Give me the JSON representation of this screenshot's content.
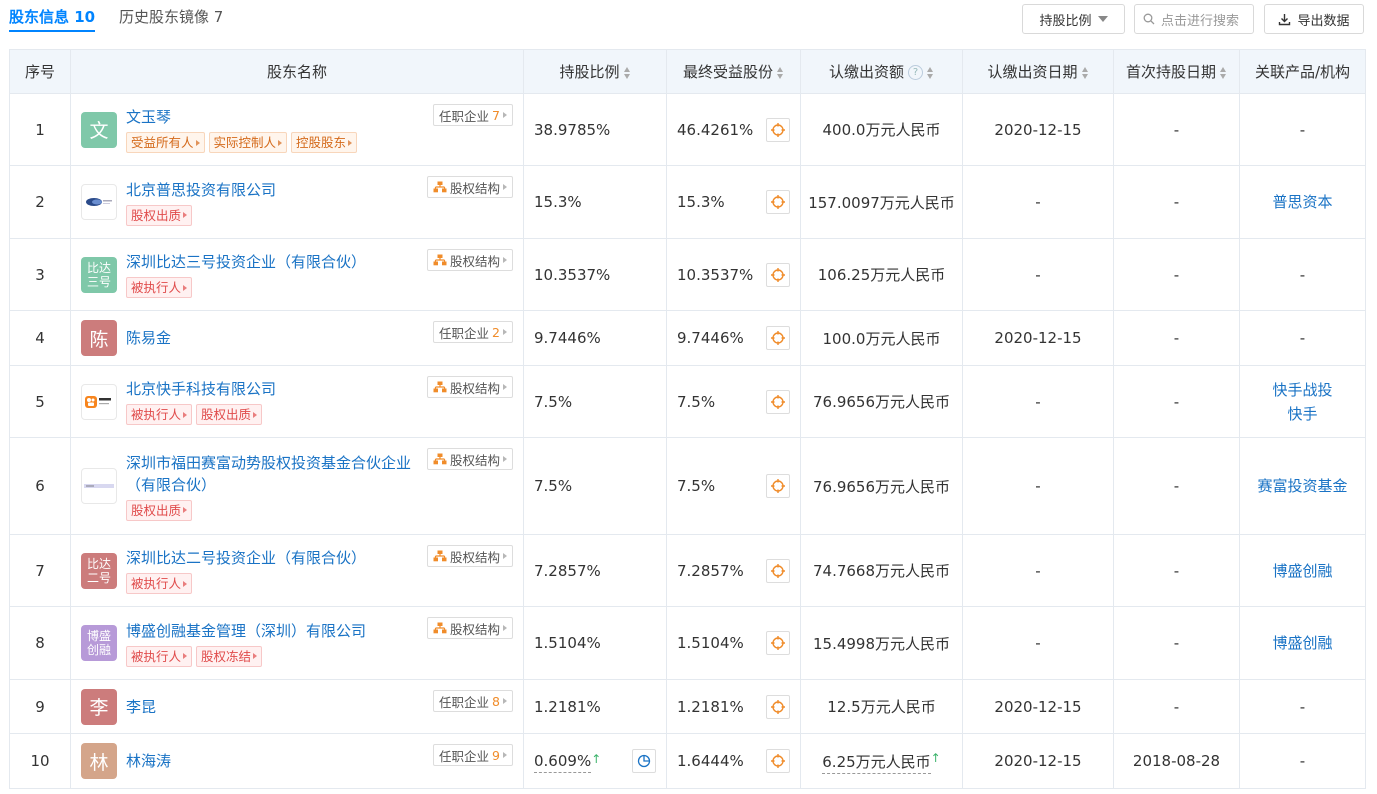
{
  "tabs": [
    {
      "label": "股东信息 10",
      "active": true
    },
    {
      "label": "历史股东镜像 7",
      "active": false
    }
  ],
  "toolbar": {
    "ratio_label": "持股比例",
    "search_placeholder": "点击进行搜索",
    "export_label": "导出数据"
  },
  "colors": {
    "accent": "#0084ff",
    "link": "#1a73c5",
    "tag_orange": "#d46a1b",
    "tag_red": "#e04b4b",
    "green_up": "#3bb36b"
  },
  "table": {
    "headers": {
      "index": "序号",
      "name": "股东名称",
      "ratio": "持股比例",
      "final_benefit": "最终受益股份",
      "subscribed_amount": "认缴出资额",
      "subscribed_date": "认缴出资日期",
      "first_hold_date": "首次持股日期",
      "related": "关联产品/机构"
    },
    "rows": [
      {
        "index": "1",
        "avatar_text": "文",
        "avatar_color": "#7fc8a9",
        "name": "文玉琴",
        "tags": [
          {
            "text": "受益所有人",
            "style": "orange"
          },
          {
            "text": "实际控制人",
            "style": "orange"
          },
          {
            "text": "控股股东",
            "style": "orange"
          }
        ],
        "side": {
          "type": "job",
          "label": "任职企业",
          "count": "7"
        },
        "ratio": "38.9785%",
        "final": "46.4261%",
        "amount": "400.0万元人民币",
        "sub_date": "2020-12-15",
        "first_date": "-",
        "related": [
          "-"
        ]
      },
      {
        "index": "2",
        "avatar_logo": "puse",
        "name": "北京普思投资有限公司",
        "tags": [
          {
            "text": "股权出质",
            "style": "red"
          }
        ],
        "side": {
          "type": "struct",
          "label": "股权结构"
        },
        "ratio": "15.3%",
        "final": "15.3%",
        "amount": "157.0097万元人民币",
        "sub_date": "-",
        "first_date": "-",
        "related": [
          "普思资本"
        ]
      },
      {
        "index": "3",
        "avatar_text": "比达三号",
        "avatar_color": "#7fc8a9",
        "name": "深圳比达三号投资企业（有限合伙）",
        "tags": [
          {
            "text": "被执行人",
            "style": "red"
          }
        ],
        "side": {
          "type": "struct",
          "label": "股权结构"
        },
        "ratio": "10.3537%",
        "final": "10.3537%",
        "amount": "106.25万元人民币",
        "sub_date": "-",
        "first_date": "-",
        "related": [
          "-"
        ]
      },
      {
        "index": "4",
        "avatar_text": "陈",
        "avatar_color": "#cc7c7c",
        "name": "陈易金",
        "tags": [],
        "side": {
          "type": "job",
          "label": "任职企业",
          "count": "2"
        },
        "ratio": "9.7446%",
        "final": "9.7446%",
        "amount": "100.0万元人民币",
        "sub_date": "2020-12-15",
        "first_date": "-",
        "related": [
          "-"
        ]
      },
      {
        "index": "5",
        "avatar_logo": "kuaishou",
        "name": "北京快手科技有限公司",
        "tags": [
          {
            "text": "被执行人",
            "style": "red"
          },
          {
            "text": "股权出质",
            "style": "red"
          }
        ],
        "side": {
          "type": "struct",
          "label": "股权结构"
        },
        "ratio": "7.5%",
        "final": "7.5%",
        "amount": "76.9656万元人民币",
        "sub_date": "-",
        "first_date": "-",
        "related": [
          "快手战投",
          "快手"
        ]
      },
      {
        "index": "6",
        "avatar_logo": "saifu",
        "name": "深圳市福田赛富动势股权投资基金合伙企业（有限合伙）",
        "tags": [
          {
            "text": "股权出质",
            "style": "red"
          }
        ],
        "side": {
          "type": "struct",
          "label": "股权结构"
        },
        "ratio": "7.5%",
        "final": "7.5%",
        "amount": "76.9656万元人民币",
        "sub_date": "-",
        "first_date": "-",
        "related": [
          "赛富投资基金"
        ]
      },
      {
        "index": "7",
        "avatar_text": "比达二号",
        "avatar_color": "#cc7c7c",
        "name": "深圳比达二号投资企业（有限合伙）",
        "tags": [
          {
            "text": "被执行人",
            "style": "red"
          }
        ],
        "side": {
          "type": "struct",
          "label": "股权结构"
        },
        "ratio": "7.2857%",
        "final": "7.2857%",
        "amount": "74.7668万元人民币",
        "sub_date": "-",
        "first_date": "-",
        "related": [
          "博盛创融"
        ]
      },
      {
        "index": "8",
        "avatar_text": "博盛创融",
        "avatar_color": "#b79ad8",
        "name": "博盛创融基金管理（深圳）有限公司",
        "tags": [
          {
            "text": "被执行人",
            "style": "red"
          },
          {
            "text": "股权冻结",
            "style": "red"
          }
        ],
        "side": {
          "type": "struct",
          "label": "股权结构"
        },
        "ratio": "1.5104%",
        "final": "1.5104%",
        "amount": "15.4998万元人民币",
        "sub_date": "-",
        "first_date": "-",
        "related": [
          "博盛创融"
        ]
      },
      {
        "index": "9",
        "avatar_text": "李",
        "avatar_color": "#cc7c7c",
        "name": "李昆",
        "tags": [],
        "side": {
          "type": "job",
          "label": "任职企业",
          "count": "8"
        },
        "ratio": "1.2181%",
        "final": "1.2181%",
        "amount": "12.5万元人民币",
        "sub_date": "2020-12-15",
        "first_date": "-",
        "related": [
          "-"
        ]
      },
      {
        "index": "10",
        "avatar_text": "林",
        "avatar_color": "#d4a58a",
        "name": "林海涛",
        "tags": [],
        "side": {
          "type": "job",
          "label": "任职企业",
          "count": "9"
        },
        "ratio": "0.609%",
        "ratio_up": true,
        "final": "1.6444%",
        "amount": "6.25万元人民币",
        "amount_up": true,
        "sub_date": "2020-12-15",
        "first_date": "2018-08-28",
        "related": [
          "-"
        ]
      }
    ]
  }
}
